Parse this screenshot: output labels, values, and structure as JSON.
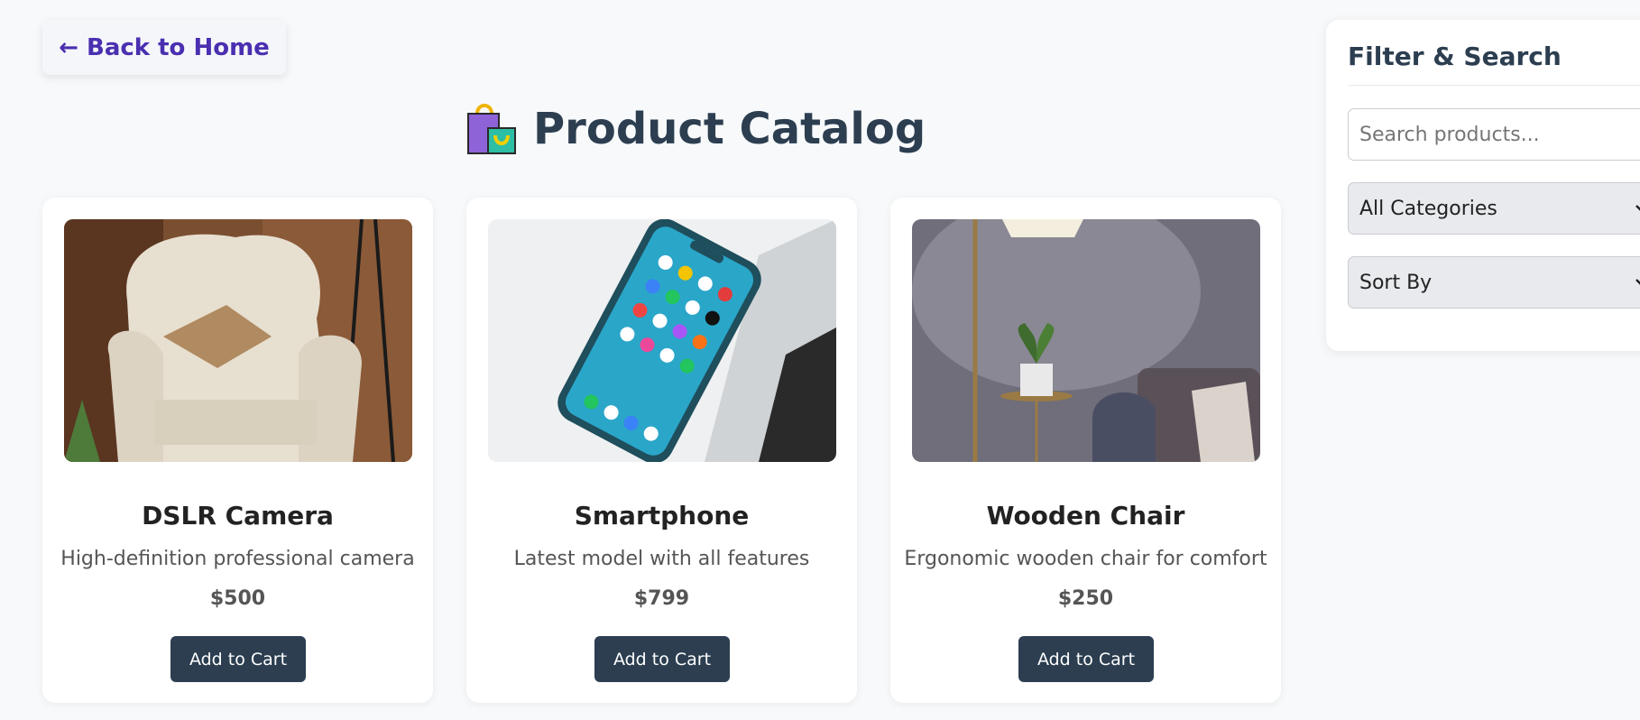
{
  "nav": {
    "back_label": "← Back to Home"
  },
  "header": {
    "title": "Product Catalog",
    "icon": "shopping-bags-icon"
  },
  "products": [
    {
      "name": "DSLR Camera",
      "description": "High-definition professional camera",
      "price": "$500",
      "button_label": "Add to Cart",
      "image": "armchair-photo"
    },
    {
      "name": "Smartphone",
      "description": "Latest model with all features",
      "price": "$799",
      "button_label": "Add to Cart",
      "image": "smartphone-photo"
    },
    {
      "name": "Wooden Chair",
      "description": "Ergonomic wooden chair for comfort",
      "price": "$250",
      "button_label": "Add to Cart",
      "image": "lamp-room-photo"
    }
  ],
  "filter": {
    "title": "Filter & Search",
    "search_placeholder": "Search products...",
    "category_selected": "All Categories",
    "sort_selected": "Sort By"
  },
  "colors": {
    "accent": "#4a2fb0",
    "heading": "#2c3e50",
    "button_bg": "#2c3e50",
    "page_bg": "#f7f9fb"
  }
}
